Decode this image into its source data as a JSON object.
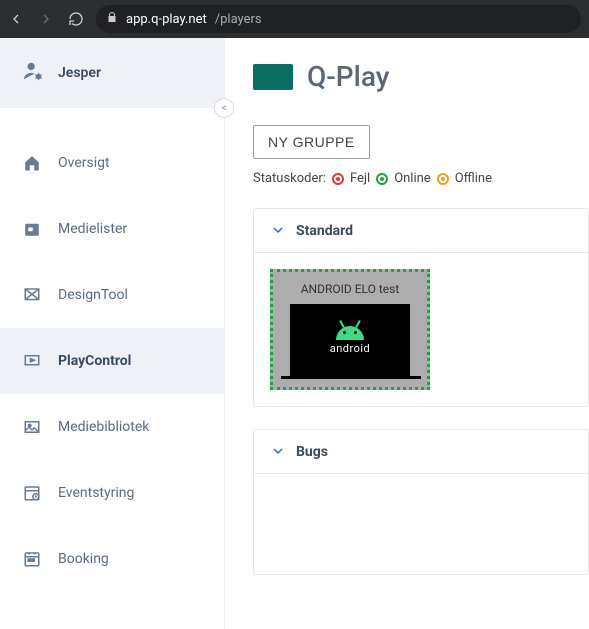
{
  "browser": {
    "url_host": "app.q-play.net",
    "url_path": "/players"
  },
  "user": {
    "name": "Jesper"
  },
  "sidebar": {
    "items": [
      {
        "label": "Oversigt",
        "icon": "house-icon"
      },
      {
        "label": "Medielister",
        "icon": "calendar-box-icon"
      },
      {
        "label": "DesignTool",
        "icon": "design-icon"
      },
      {
        "label": "PlayControl",
        "icon": "playcontrol-icon",
        "active": true
      },
      {
        "label": "Mediebibliotek",
        "icon": "gallery-icon"
      },
      {
        "label": "Eventstyring",
        "icon": "event-icon"
      },
      {
        "label": "Booking",
        "icon": "booking-icon"
      }
    ]
  },
  "brand": {
    "name": "Q-Play",
    "logo_color": "#0b6d63"
  },
  "actions": {
    "new_group": "NY GRUPPE"
  },
  "status": {
    "label": "Statuskoder:",
    "codes": [
      {
        "label": "Fejl",
        "color": "red"
      },
      {
        "label": "Online",
        "color": "green"
      },
      {
        "label": "Offline",
        "color": "orange"
      }
    ]
  },
  "groups": [
    {
      "name": "Standard",
      "players": [
        {
          "label": "ANDROID ELO test",
          "os_text": "android",
          "status": "online"
        }
      ]
    },
    {
      "name": "Bugs",
      "players": []
    }
  ]
}
